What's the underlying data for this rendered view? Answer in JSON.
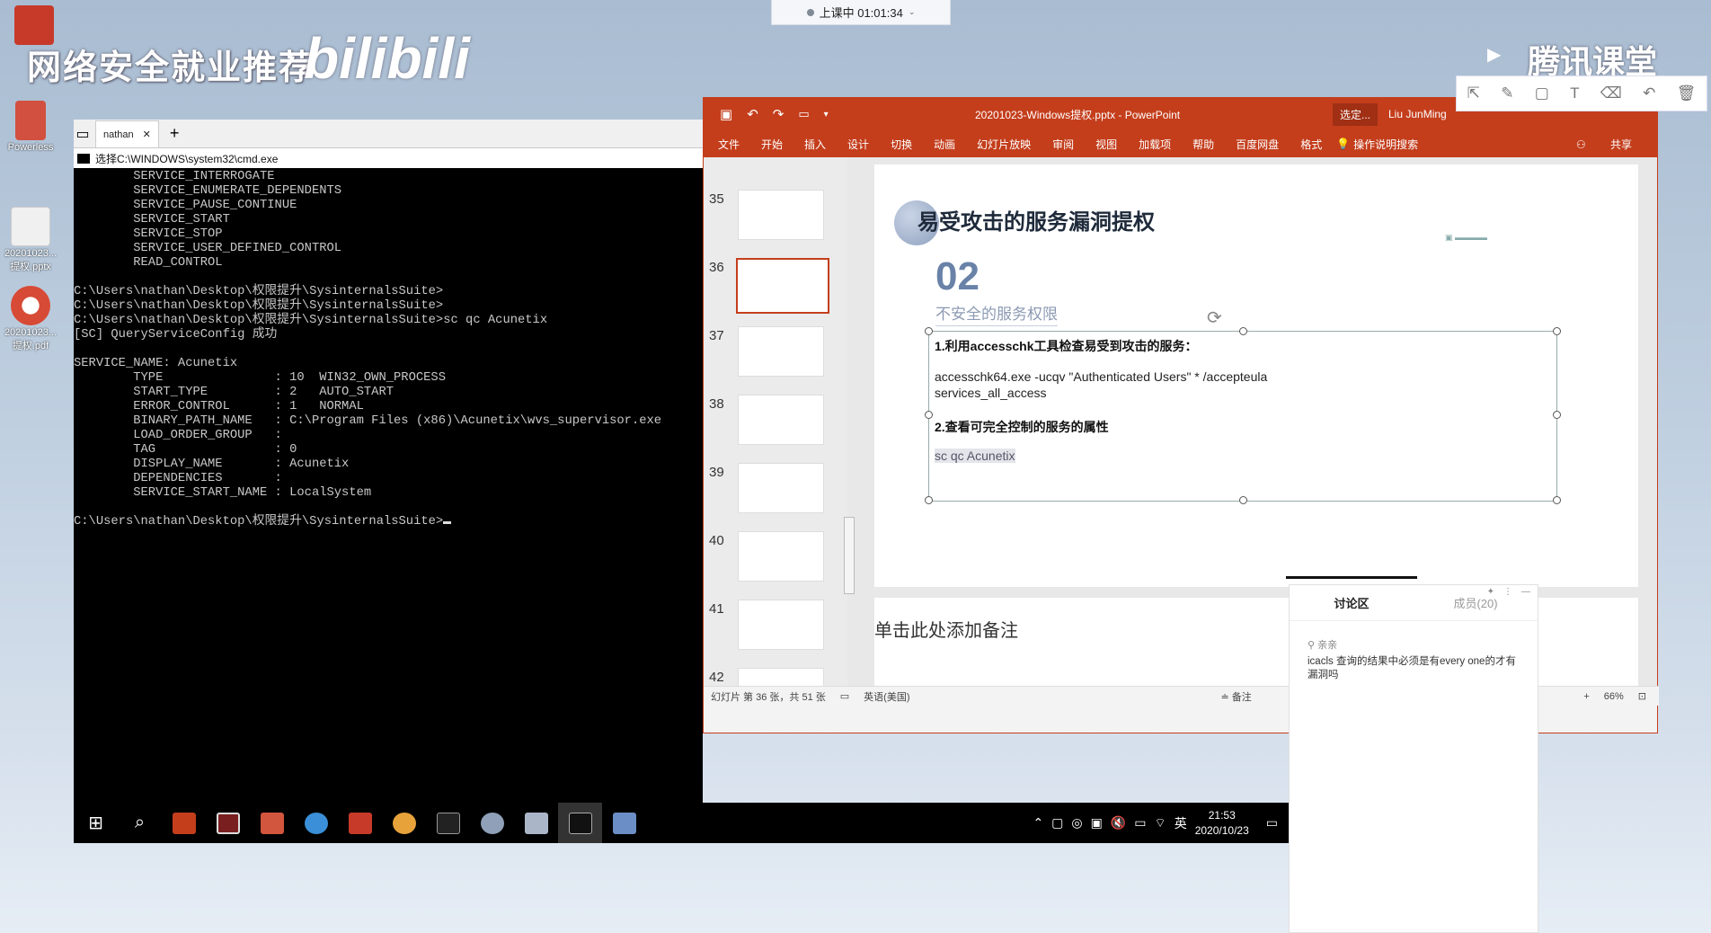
{
  "overlay": {
    "live_status": "上课中 01:01:34",
    "watermark": "网络安全就业推荐",
    "watermark_logo": "bilibili",
    "platform": "腾讯课堂"
  },
  "desktop": {
    "icons": [
      {
        "label": "Powerless",
        "icon": "app-icon"
      },
      {
        "label": "20201023...提权.pptx",
        "icon": "pptx-file-icon"
      },
      {
        "label": "20201023...提权.pdf",
        "icon": "pdf-file-icon"
      }
    ]
  },
  "cmd": {
    "tab_label": "nathan",
    "title": "选择C:\\WINDOWS\\system32\\cmd.exe",
    "lines": [
      "        SERVICE_INTERROGATE",
      "        SERVICE_ENUMERATE_DEPENDENTS",
      "        SERVICE_PAUSE_CONTINUE",
      "        SERVICE_START",
      "        SERVICE_STOP",
      "        SERVICE_USER_DEFINED_CONTROL",
      "        READ_CONTROL",
      "",
      "C:\\Users\\nathan\\Desktop\\权限提升\\SysinternalsSuite>",
      "C:\\Users\\nathan\\Desktop\\权限提升\\SysinternalsSuite>",
      "C:\\Users\\nathan\\Desktop\\权限提升\\SysinternalsSuite>sc qc Acunetix",
      "[SC] QueryServiceConfig 成功",
      "",
      "SERVICE_NAME: Acunetix",
      "        TYPE               : 10  WIN32_OWN_PROCESS",
      "        START_TYPE         : 2   AUTO_START",
      "        ERROR_CONTROL      : 1   NORMAL",
      "        BINARY_PATH_NAME   : C:\\Program Files (x86)\\Acunetix\\wvs_supervisor.exe",
      "        LOAD_ORDER_GROUP   :",
      "        TAG                : 0",
      "        DISPLAY_NAME       : Acunetix",
      "        DEPENDENCIES       :",
      "        SERVICE_START_NAME : LocalSystem",
      "",
      "C:\\Users\\nathan\\Desktop\\权限提升\\SysinternalsSuite>"
    ]
  },
  "taskbar": {
    "time": "21:53",
    "date": "2020/10/23",
    "ime": "英"
  },
  "ppt": {
    "file_title": "20201023-Windows提权.pptx  -  PowerPoint",
    "user": "Liu JunMing",
    "badge": "选定...",
    "ribbon": [
      "文件",
      "开始",
      "插入",
      "设计",
      "切换",
      "动画",
      "幻灯片放映",
      "审阅",
      "视图",
      "加载项",
      "帮助",
      "百度网盘",
      "格式"
    ],
    "search": "操作说明搜索",
    "share": "共享",
    "thumb_numbers": [
      "35",
      "36",
      "37",
      "38",
      "39",
      "40",
      "41",
      "42"
    ],
    "slide": {
      "title": "易受攻击的服务漏洞提权",
      "number": "02",
      "subtitle": "不安全的服务权限",
      "h1": "1.利用accesschk工具检查易受到攻击的服务：",
      "cmd1": "accesschk64.exe -ucqv \"Authenticated Users\" * /accepteula",
      "cmd1b": "services_all_access",
      "h2": "2.查看可完全控制的服务的属性",
      "cmd2": "sc qc Acunetix"
    },
    "notes_placeholder": "单击此处添加备注",
    "status": {
      "slide_count": "幻灯片 第 36 张，共 51 张",
      "language": "英语(美国)",
      "notes": "备注",
      "zoom": "66%"
    }
  },
  "chat": {
    "tab_discuss": "讨论区",
    "tab_members": "成员(20)",
    "user": "亲亲",
    "message": "icacls 查询的结果中必须是有every one的才有漏洞吗"
  }
}
